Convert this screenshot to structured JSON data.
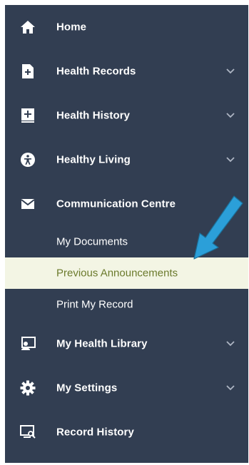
{
  "nav": {
    "items": [
      {
        "label": "Home",
        "icon": "home-icon",
        "expandable": false
      },
      {
        "label": "Health Records",
        "icon": "medical-file-icon",
        "expandable": true
      },
      {
        "label": "Health History",
        "icon": "medical-chart-icon",
        "expandable": true
      },
      {
        "label": "Healthy Living",
        "icon": "accessibility-icon",
        "expandable": true
      },
      {
        "label": "Communication Centre",
        "icon": "envelope-icon",
        "expandable": false,
        "expanded": true
      },
      {
        "label": "My Health Library",
        "icon": "library-user-icon",
        "expandable": true
      },
      {
        "label": "My Settings",
        "icon": "gear-icon",
        "expandable": true
      },
      {
        "label": "Record History",
        "icon": "monitor-search-icon",
        "expandable": false
      }
    ],
    "subitems": [
      {
        "label": "My Documents",
        "active": false
      },
      {
        "label": "Previous Announcements",
        "active": true
      },
      {
        "label": "Print My Record",
        "active": false
      }
    ]
  },
  "colors": {
    "sidebar_bg": "#323e52",
    "active_bg": "#f3f5e4",
    "active_text": "#6b7a2c",
    "annotation_arrow": "#2b9fd9"
  }
}
